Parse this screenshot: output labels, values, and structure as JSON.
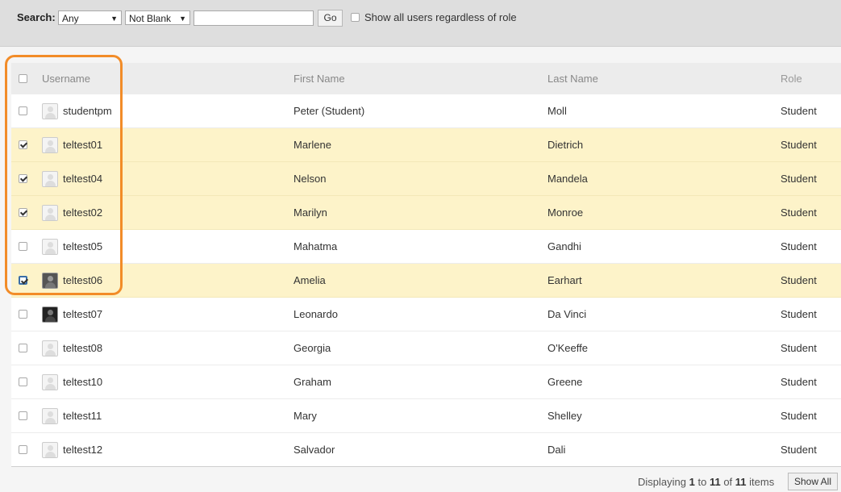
{
  "search": {
    "label": "Search:",
    "field_select": "Any",
    "condition_select": "Not Blank",
    "text_value": "",
    "go_label": "Go",
    "show_all_users_label": "Show all users regardless of role"
  },
  "table": {
    "columns": [
      "Username",
      "First Name",
      "Last Name",
      "Role"
    ],
    "rows": [
      {
        "username": "studentpm",
        "first": "Peter (Student)",
        "last": "Moll",
        "role": "Student",
        "checked": false,
        "avatar": "default"
      },
      {
        "username": "teltest01",
        "first": "Marlene",
        "last": "Dietrich",
        "role": "Student",
        "checked": true,
        "avatar": "default"
      },
      {
        "username": "teltest04",
        "first": "Nelson",
        "last": "Mandela",
        "role": "Student",
        "checked": true,
        "avatar": "default"
      },
      {
        "username": "teltest02",
        "first": "Marilyn",
        "last": "Monroe",
        "role": "Student",
        "checked": true,
        "avatar": "default"
      },
      {
        "username": "teltest05",
        "first": "Mahatma",
        "last": "Gandhi",
        "role": "Student",
        "checked": false,
        "avatar": "default"
      },
      {
        "username": "teltest06",
        "first": "Amelia",
        "last": "Earhart",
        "role": "Student",
        "checked": true,
        "avatar": "photo"
      },
      {
        "username": "teltest07",
        "first": "Leonardo",
        "last": "Da Vinci",
        "role": "Student",
        "checked": false,
        "avatar": "photo-dark"
      },
      {
        "username": "teltest08",
        "first": "Georgia",
        "last": "O'Keeffe",
        "role": "Student",
        "checked": false,
        "avatar": "default"
      },
      {
        "username": "teltest10",
        "first": "Graham",
        "last": "Greene",
        "role": "Student",
        "checked": false,
        "avatar": "default"
      },
      {
        "username": "teltest11",
        "first": "Mary",
        "last": "Shelley",
        "role": "Student",
        "checked": false,
        "avatar": "default"
      },
      {
        "username": "teltest12",
        "first": "Salvador",
        "last": "Dali",
        "role": "Student",
        "checked": false,
        "avatar": "default"
      }
    ]
  },
  "footer": {
    "prefix": "Displaying",
    "from": "1",
    "to_word": "to",
    "to": "11",
    "of_word": "of",
    "total": "11",
    "suffix": "items",
    "show_all_label": "Show All"
  },
  "colors": {
    "selected_row": "#fdf3c9",
    "highlight": "#f28c28"
  }
}
